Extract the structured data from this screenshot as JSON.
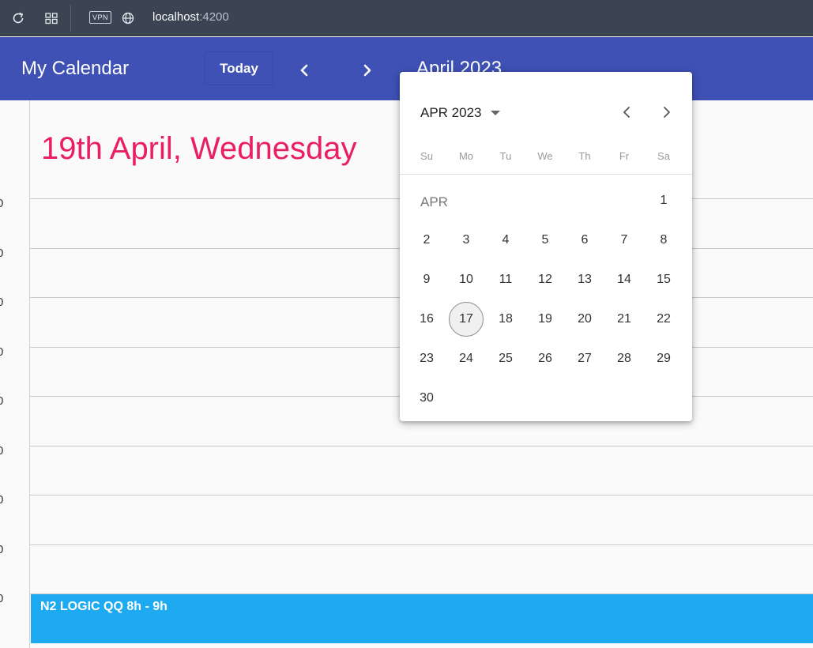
{
  "browser": {
    "vpn_label": "VPN",
    "url_host": "localhost",
    "url_port": ":4200"
  },
  "toolbar": {
    "title": "My Calendar",
    "today_label": "Today",
    "month_label": "April 2023"
  },
  "day_view": {
    "heading": "19th April, Wednesday",
    "time_labels": [
      "0",
      "0",
      "0",
      "0",
      "0",
      "0",
      "0",
      "0",
      "0"
    ],
    "event": {
      "label": "N2 LOGIC QQ 8h - 9h",
      "color": "#1eaaf1"
    }
  },
  "datepicker": {
    "period_label": "APR 2023",
    "weekdays": [
      "Su",
      "Mo",
      "Tu",
      "We",
      "Th",
      "Fr",
      "Sa"
    ],
    "month_label": "APR",
    "today": 17,
    "weeks": [
      [
        null,
        null,
        null,
        null,
        null,
        null,
        1
      ],
      [
        2,
        3,
        4,
        5,
        6,
        7,
        8
      ],
      [
        9,
        10,
        11,
        12,
        13,
        14,
        15
      ],
      [
        16,
        17,
        18,
        19,
        20,
        21,
        22
      ],
      [
        23,
        24,
        25,
        26,
        27,
        28,
        29
      ],
      [
        30,
        null,
        null,
        null,
        null,
        null,
        null
      ]
    ]
  },
  "colors": {
    "toolbar": "#3f51b5",
    "heading": "#e91e63",
    "event": "#1eaaf1",
    "browser_bar": "#3a4452"
  },
  "icons": {
    "reload": "reload-icon",
    "tabs": "tabs-grid-icon",
    "globe": "globe-icon",
    "prev": "chevron-left-icon",
    "next": "chevron-right-icon",
    "caret": "caret-down-icon"
  }
}
